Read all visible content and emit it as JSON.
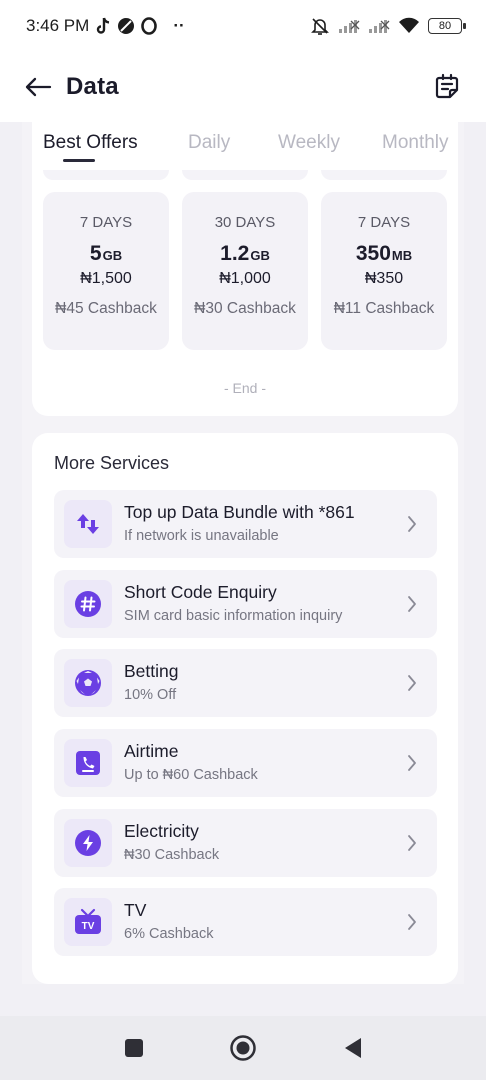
{
  "status_bar": {
    "time": "3:46 PM",
    "extra": "··",
    "battery": "80",
    "icons": [
      "tiktok-icon",
      "no-sign-icon",
      "opera-icon",
      "silent-bell-icon",
      "signal-icon",
      "signal-icon",
      "wifi-icon",
      "battery-icon"
    ]
  },
  "header": {
    "title": "Data",
    "back_icon": "arrow-left-icon",
    "action_icon": "notes-icon"
  },
  "tabs": [
    {
      "label": "Best Offers",
      "active": true
    },
    {
      "label": "Daily",
      "active": false
    },
    {
      "label": "Weekly",
      "active": false
    },
    {
      "label": "Monthly",
      "active": false
    }
  ],
  "plans": [
    {
      "duration": "7 DAYS",
      "size": "5",
      "unit": "GB",
      "price": "₦1,500",
      "cashback": "₦45 Cashback"
    },
    {
      "duration": "30 DAYS",
      "size": "1.2",
      "unit": "GB",
      "price": "₦1,000",
      "cashback": "₦30 Cashback"
    },
    {
      "duration": "7 DAYS",
      "size": "350",
      "unit": "MB",
      "price": "₦350",
      "cashback": "₦11 Cashback"
    }
  ],
  "end_label": "- End -",
  "services": {
    "title": "More Services",
    "items": [
      {
        "title": "Top up Data Bundle with *861",
        "subtitle": "If network is unavailable",
        "icon": "transfer-arrows-icon"
      },
      {
        "title": "Short Code Enquiry",
        "subtitle": "SIM card basic information inquiry",
        "icon": "hash-icon"
      },
      {
        "title": "Betting",
        "subtitle": "10% Off",
        "icon": "soccer-ball-icon"
      },
      {
        "title": "Airtime",
        "subtitle": "Up to ₦60 Cashback",
        "icon": "phone-icon"
      },
      {
        "title": "Electricity",
        "subtitle": "₦30 Cashback",
        "icon": "lightning-icon"
      },
      {
        "title": "TV",
        "subtitle": "6% Cashback",
        "icon": "tv-icon",
        "icon_text": "TV"
      }
    ]
  },
  "nav": {
    "icons": [
      "recents-square-icon",
      "home-circle-icon",
      "back-triangle-icon"
    ]
  },
  "colors": {
    "accent": "#6a3fe3",
    "icon_bg": "#ece8f8",
    "card_bg": "#f3f2f7"
  }
}
